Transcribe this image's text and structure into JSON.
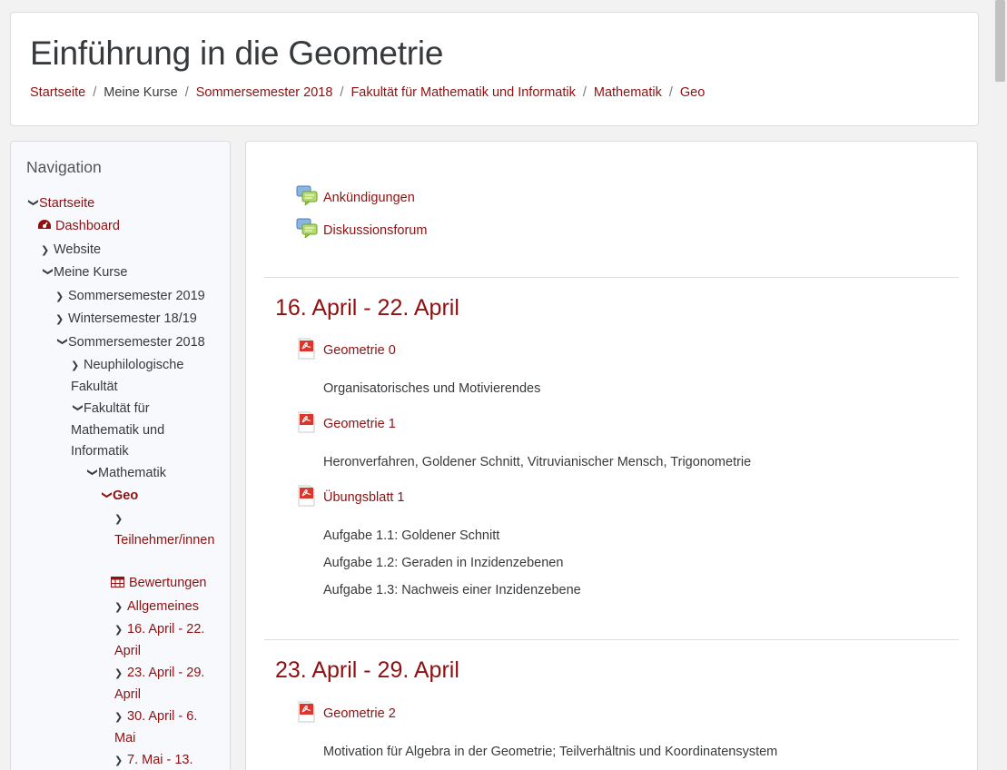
{
  "header": {
    "title": "Einführung in die Geometrie",
    "breadcrumb": [
      "Startseite",
      "Meine Kurse",
      "Sommersemester 2018",
      "Fakultät für Mathematik und Informatik",
      "Mathematik",
      "Geo"
    ]
  },
  "nav": {
    "title": "Navigation",
    "items": [
      "Startseite",
      "Dashboard",
      "Website",
      "Meine Kurse",
      "Sommersemester 2019",
      "Wintersemester 18/19",
      "Sommersemester 2018",
      "Neuphilologische Fakultät",
      "Fakultät für Mathematik und Informatik",
      "Mathematik",
      "Geo",
      "Teilnehmer/innen",
      "Bewertungen",
      "Allgemeines",
      "16. April - 22. April",
      "23. April - 29. April",
      "30. April - 6. Mai",
      "7. Mai - 13."
    ]
  },
  "main": {
    "general": [
      "Ankündigungen",
      "Diskussionsforum"
    ],
    "sections": [
      {
        "title": "16. April - 22. April",
        "activities": [
          {
            "name": "Geometrie 0",
            "desc": [
              "Organisatorisches und Motivierendes"
            ]
          },
          {
            "name": "Geometrie 1",
            "desc": [
              "Heronverfahren, Goldener Schnitt, Vitruvianischer Mensch, Trigonometrie"
            ]
          },
          {
            "name": "Übungsblatt 1",
            "desc": [
              "Aufgabe 1.1: Goldener Schnitt",
              "Aufgabe 1.2: Geraden in Inzidenzebenen",
              "Aufgabe 1.3: Nachweis einer Inzidenzebene"
            ]
          }
        ]
      },
      {
        "title": "23. April - 29. April",
        "activities": [
          {
            "name": "Geometrie 2",
            "desc": [
              "Motivation für Algebra in der Geometrie; Teilverhältnis und Koordinatensystem"
            ]
          }
        ]
      }
    ]
  },
  "colors": {
    "link": "#8f1010",
    "text": "#373a3c",
    "background": "#f2f2f2"
  },
  "icons": [
    "chevron-right-icon",
    "chevron-down-icon",
    "dashboard-icon",
    "table-icon",
    "forum-icon",
    "pdf-icon"
  ]
}
